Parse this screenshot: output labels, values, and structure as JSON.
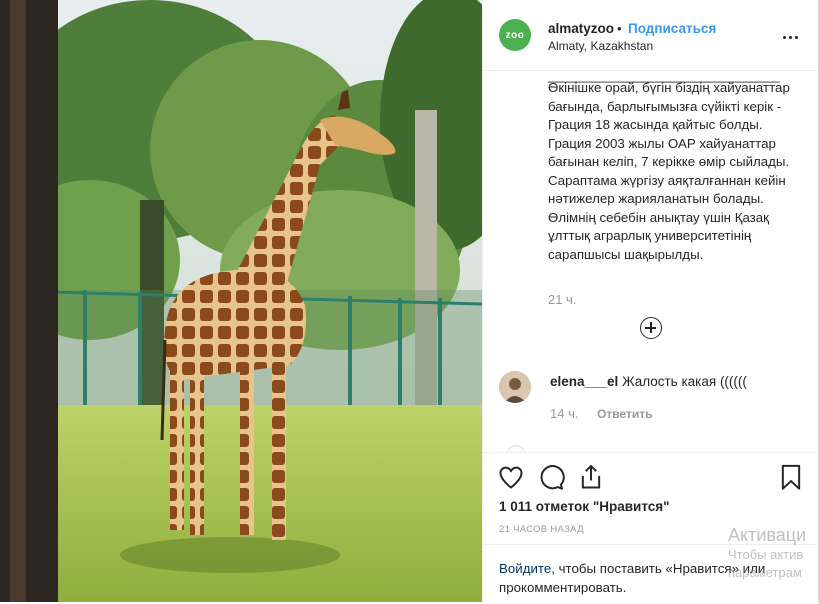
{
  "post": {
    "username": "almatyzoo",
    "dot": "•",
    "follow_label": "Подписаться",
    "location": "Almaty, Kazakhstan",
    "avatar_text": "zoo",
    "separator": "________________________________",
    "caption": "Өкінішке орай, бүгін біздің хайуанаттар бағында, барлығымызға сүйікті керік - Грация 18 жасында қайтыс болды. Грация 2003 жылы ОАР хайуанаттар бағынан келіп, 7 керікке өмір сыйлады. Сарaптама жүргізу аяқталғаннан кейін нәтижелер жарияланатын болады. Өлімнің себебін анықтау үшін Қазақ ұлттық аграрлық университетінің сарапшысы шақырылды.",
    "caption_time": "21 ч."
  },
  "comments": [
    {
      "username": "elena___el",
      "text": "Жалость какая ((((((",
      "time": "14 ч.",
      "reply_label": "Ответить"
    }
  ],
  "actions": {
    "likes": "1 011 отметок \"Нравится\"",
    "posted_ago": "21 ЧАСОВ НАЗАД",
    "icons": [
      "heart-icon",
      "comment-icon",
      "share-icon",
      "bookmark-icon"
    ]
  },
  "login_prompt": {
    "link": "Войдите",
    "text": ", чтобы поставить «Нравится» или прокомментировать."
  },
  "watermark": {
    "line1": "Активаци",
    "line2": "Чтобы актив",
    "line3": "параметрам"
  },
  "colors": {
    "accent": "#3897f0",
    "text": "#262626",
    "muted": "#999999",
    "link": "#003569"
  }
}
